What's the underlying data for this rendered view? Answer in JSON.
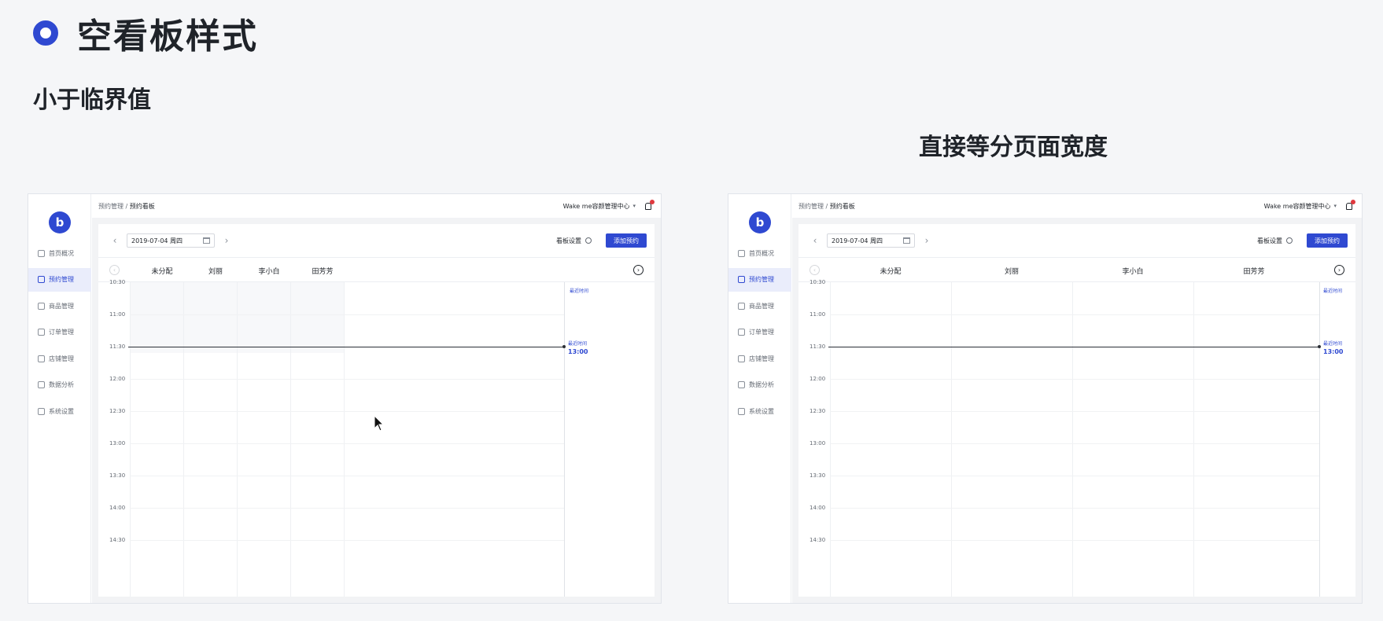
{
  "slide": {
    "title": "空看板样式",
    "subtitle": "小于临界值",
    "panel_heading": "直接等分页面宽度"
  },
  "app": {
    "logo_text": "b",
    "breadcrumb_parent": "预约管理",
    "breadcrumb_separator": " / ",
    "breadcrumb_current": "预约看板",
    "center_name": "Wake me容颜管理中心",
    "nav": [
      "首页概况",
      "预约管理",
      "商品管理",
      "订单管理",
      "店铺管理",
      "数据分析",
      "系统设置"
    ],
    "active_nav_index": 1,
    "date_value": "2019-07-04 周四",
    "board_settings_label": "看板设置",
    "add_button_label": "添加预约",
    "staff_columns": [
      "未分配",
      "刘丽",
      "李小白",
      "田芳芳"
    ],
    "time_labels": [
      "10:30",
      "11:00",
      "11:30",
      "12:00",
      "12:30",
      "13:00",
      "13:30",
      "14:00",
      "14:30"
    ],
    "recent_label": "最近时间",
    "now_marker_label": "最近时间",
    "now_marker_time": "13:00",
    "prev_icon": "chevron-left-circle-icon",
    "next_icon": "chevron-right-circle-icon"
  }
}
